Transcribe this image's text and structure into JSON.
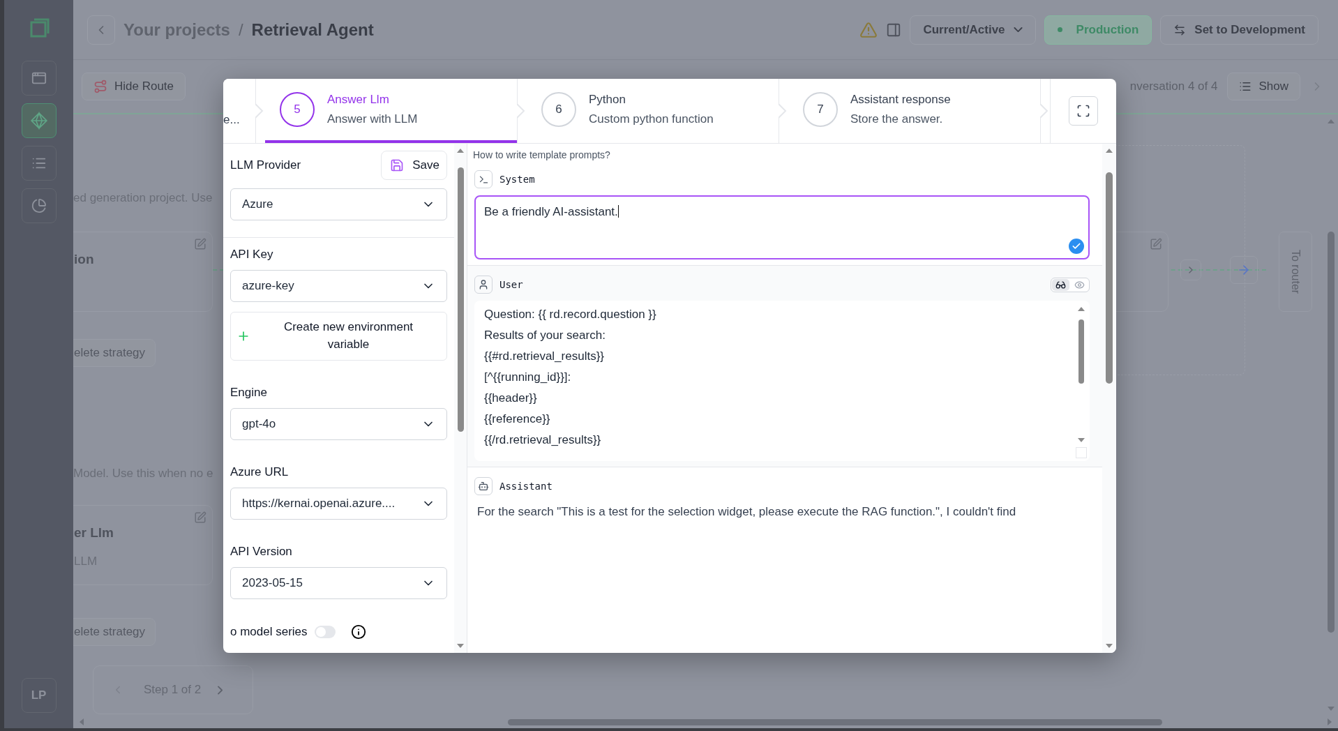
{
  "app_sidebar": {
    "items": [
      {
        "selected": false
      },
      {
        "selected": true
      },
      {
        "selected": false
      },
      {
        "selected": false
      }
    ],
    "user_initials": "LP"
  },
  "header": {
    "breadcrumb_parent": "Your projects",
    "separator": "/",
    "title": "Retrieval Agent",
    "version_select": "Current/Active",
    "environment": "Production",
    "switch_button": "Set to Development"
  },
  "toolbar": {
    "hide_route": "Hide Route",
    "conversation": "nversation 4 of 4",
    "show": "Show"
  },
  "canvas": {
    "intro_texts": [
      "ed generation project. Use",
      "Model. Use this when no e"
    ],
    "nodes": [
      {
        "title": "ion"
      },
      {
        "title": "er Llm",
        "subtitle": "LLM"
      }
    ],
    "delete_buttons": [
      "elete strategy",
      "elete strategy"
    ],
    "router_label": "To router",
    "pager": "Step 1 of 2"
  },
  "dialog": {
    "steps": [
      {
        "kind": "partial",
        "title": "e...",
        "selected": false
      },
      {
        "kind": "step",
        "number": "5",
        "title": "Answer Llm",
        "subtitle": "Answer with LLM",
        "selected": true
      },
      {
        "kind": "step",
        "number": "6",
        "title": "Python",
        "subtitle": "Custom python function",
        "selected": false
      },
      {
        "kind": "step",
        "number": "7",
        "title": "Assistant response",
        "subtitle": "Store the answer.",
        "selected": false
      }
    ],
    "form": {
      "save": "Save",
      "fields": [
        {
          "kind": "select",
          "label": "LLM Provider",
          "value": "Azure"
        },
        {
          "kind": "select",
          "label": "API Key",
          "value": "azure-key"
        },
        {
          "kind": "action",
          "label": "Create new environment variable"
        },
        {
          "kind": "select",
          "label": "Engine",
          "value": "gpt-4o"
        },
        {
          "kind": "select",
          "label": "Azure URL",
          "value": "https://kernai.openai.azure...."
        },
        {
          "kind": "select",
          "label": "API Version",
          "value": "2023-05-15"
        },
        {
          "kind": "toggle",
          "label": "o model series",
          "on": false
        }
      ]
    },
    "help_link": "How to write template prompts?",
    "prompts": [
      {
        "kind": "system",
        "role": "System",
        "text": "Be a friendly AI-assistant.",
        "focused": true
      },
      {
        "kind": "user",
        "role": "User",
        "view_options": [
          {
            "selected": true
          },
          {
            "selected": false
          }
        ],
        "lines": [
          "Question: {{ rd.record.question }}",
          "Results of your search:",
          "{{#rd.retrieval_results}}",
          "[^{{running_id}}]:",
          "{{header}}",
          "{{reference}}",
          "{{/rd.retrieval_results}}"
        ],
        "focused": false
      },
      {
        "kind": "assistant",
        "role": "Assistant",
        "text": "For the search \"This is a test for the selection widget, please execute the RAG function.\", I couldn't find"
      }
    ]
  }
}
